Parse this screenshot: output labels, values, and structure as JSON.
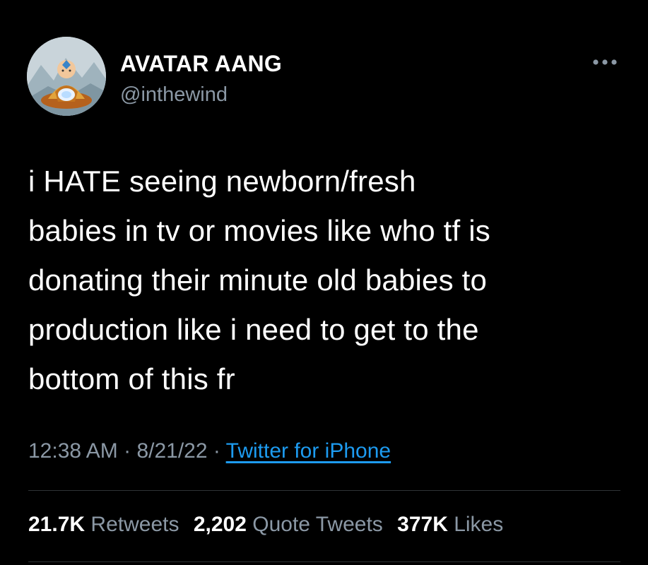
{
  "profile": {
    "display_name": "AVATAR AANG",
    "handle": "@inthewind",
    "avatar_icon": "avatar-aang-icon",
    "more_icon": "more-options-icon"
  },
  "tweet": {
    "lines": [
      "i HATE seeing newborn/fresh",
      "babies in tv or movies like who tf is",
      "donating their minute old babies to",
      "production like i need to get to the",
      "bottom of this fr"
    ]
  },
  "meta": {
    "time": "12:38 AM",
    "separator": " · ",
    "date": "8/21/22",
    "source": "Twitter for iPhone"
  },
  "stats": {
    "retweets_count": "21.7K",
    "retweets_label": "Retweets",
    "quotes_count": "2,202",
    "quotes_label": "Quote Tweets",
    "likes_count": "377K",
    "likes_label": "Likes"
  },
  "colors": {
    "background": "#000000",
    "text_primary": "#ffffff",
    "text_secondary": "#8b98a5",
    "link": "#1d9bf0",
    "divider": "#2f3336"
  }
}
